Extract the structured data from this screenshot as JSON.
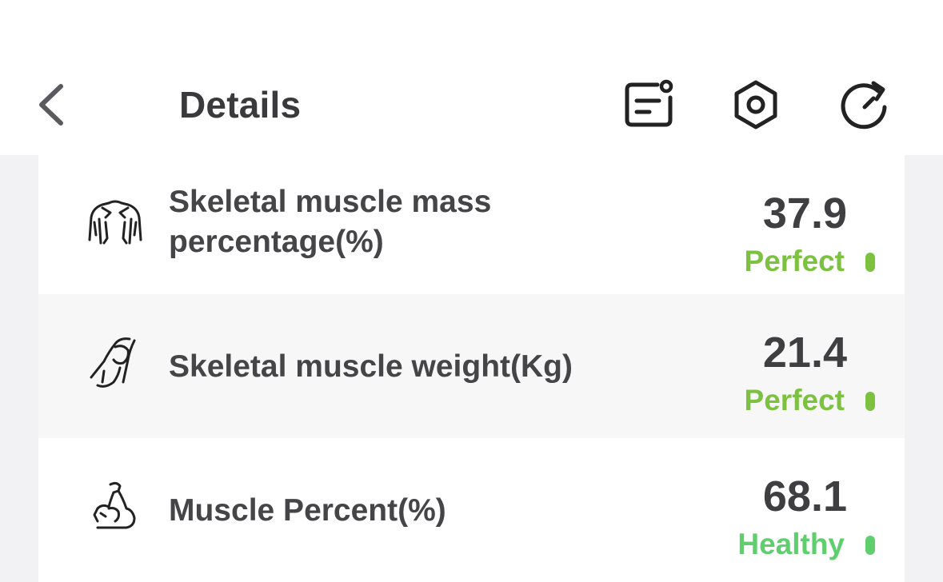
{
  "header": {
    "title": "Details",
    "back_icon": "chevron-left-icon",
    "actions": [
      {
        "name": "notes-icon"
      },
      {
        "name": "settings-hexagon-icon"
      },
      {
        "name": "refresh-icon"
      }
    ]
  },
  "metrics": [
    {
      "icon": "shoulders-muscle-icon",
      "label_line1": "Skeletal muscle mass",
      "label_line2": "percentage(%)",
      "value": "37.9",
      "status": "Perfect",
      "status_color": "#7cc240"
    },
    {
      "icon": "arm-muscle-icon",
      "label_line1": "Skeletal muscle weight(Kg)",
      "value": "21.4",
      "status": "Perfect",
      "status_color": "#7cc240"
    },
    {
      "icon": "flexed-bicep-icon",
      "label_line1": "Muscle Percent(%)",
      "value": "68.1",
      "status": "Healthy",
      "status_color": "#5fcf6e"
    }
  ]
}
